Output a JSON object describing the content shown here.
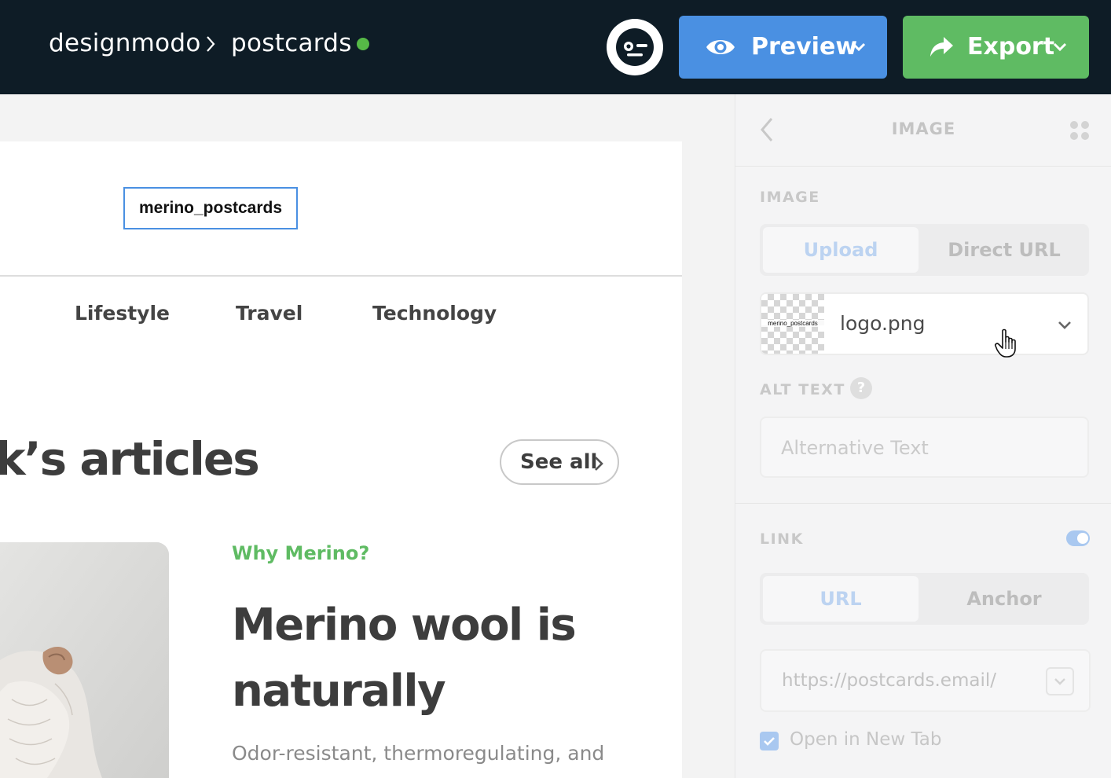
{
  "topbar": {
    "brand": "designmodo",
    "project": "postcards",
    "status": "online",
    "preview_label": "Preview",
    "export_label": "Export"
  },
  "email": {
    "logo_text": "merino_postcards",
    "nav": [
      "Lifestyle",
      "Travel",
      "Technology"
    ],
    "section_title": "k’s articles",
    "see_all_label": "See all",
    "kicker": "Why Merino?",
    "headline": "Merino wool is naturally",
    "body": "Odor-resistant, thermoregulating, and"
  },
  "panel": {
    "title": "IMAGE",
    "image_section_label": "IMAGE",
    "image_tabs": [
      "Upload",
      "Direct URL"
    ],
    "image_tab_active": "Upload",
    "file_name": "logo.png",
    "thumb_text": "merino_postcards",
    "alt_text_label": "ALT TEXT",
    "alt_text_help": "?",
    "alt_text_placeholder": "Alternative Text",
    "link_section_label": "LINK",
    "link_enabled": true,
    "link_tabs": [
      "URL",
      "Anchor"
    ],
    "link_tab_active": "URL",
    "url_value": "https://postcards.email/",
    "open_new_tab_label": "Open in New Tab",
    "open_new_tab_checked": true
  },
  "icons": {
    "crumb_separator": "chevron-right-icon",
    "preview": "eye-icon",
    "export": "share-arrow-icon",
    "dropdown": "chevron-down-icon",
    "back": "chevron-left-icon",
    "grip": "grid-dots-icon",
    "cursor": "hand-pointer-icon"
  },
  "colors": {
    "topbar_bg": "#0e1c26",
    "preview_bg": "#4a90e2",
    "export_bg": "#5fbb63",
    "status_dot": "#56b947",
    "selection_outline": "#4a90e2",
    "kicker": "#5fbb63"
  }
}
